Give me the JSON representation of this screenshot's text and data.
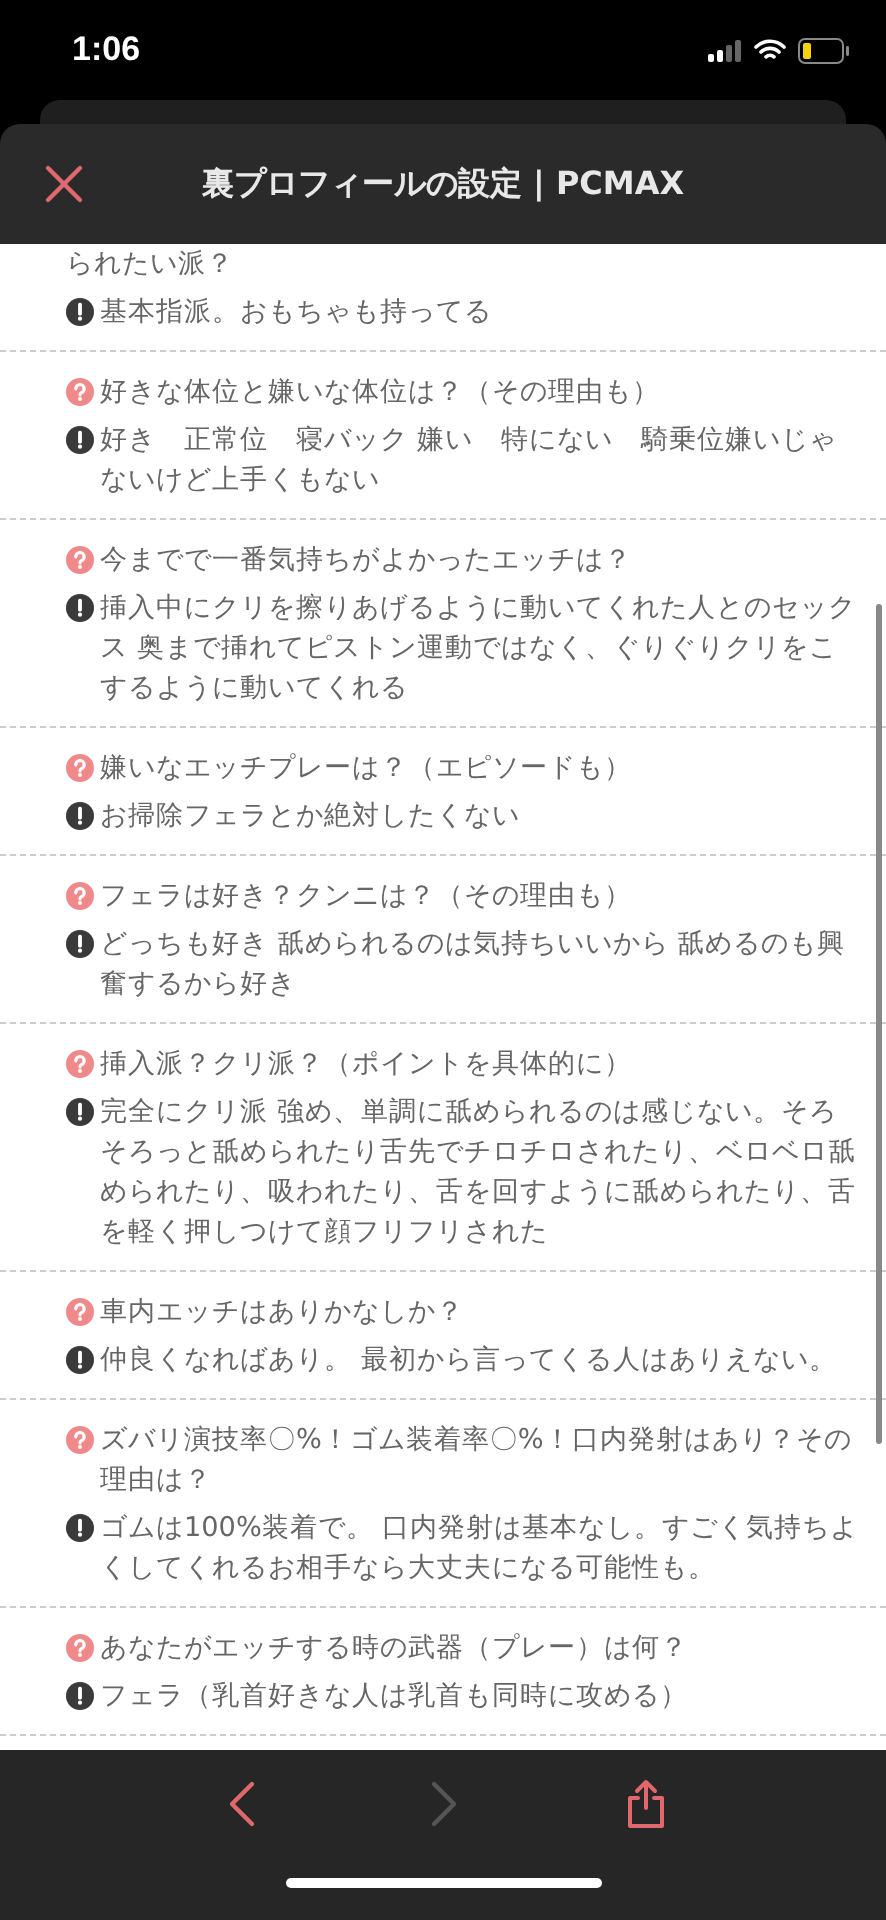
{
  "status_bar": {
    "time": "1:06"
  },
  "header": {
    "title": "裏プロフィールの設定 | PCMAX"
  },
  "items": [
    {
      "kind": "continued",
      "question": "られたい派？",
      "answer": "基本指派。おもちゃも持ってる"
    },
    {
      "kind": "full",
      "question": "好きな体位と嫌いな体位は？（その理由も）",
      "answer": "好き　正常位　寝バック 嫌い　特にない　騎乗位嫌いじゃないけど上手くもない"
    },
    {
      "kind": "full",
      "question": "今までで一番気持ちがよかったエッチは？",
      "answer": "挿入中にクリを擦りあげるように動いてくれた人とのセックス 奥まで挿れてピストン運動ではなく、ぐりぐりクリをこするように動いてくれる"
    },
    {
      "kind": "full",
      "question": "嫌いなエッチプレーは？（エピソードも）",
      "answer": "お掃除フェラとか絶対したくない"
    },
    {
      "kind": "full",
      "question": "フェラは好き？クンニは？（その理由も）",
      "answer": "どっちも好き 舐められるのは気持ちいいから 舐めるのも興奮するから好き"
    },
    {
      "kind": "full",
      "question": "挿入派？クリ派？（ポイントを具体的に）",
      "answer": "完全にクリ派 強め、単調に舐められるのは感じない。そろそろっと舐められたり舌先でチロチロされたり、ベロベロ舐められたり、吸われたり、舌を回すように舐められたり、舌を軽く押しつけて顔フリフリされた"
    },
    {
      "kind": "full",
      "question": "車内エッチはありかなしか？",
      "answer": "仲良くなればあり。 最初から言ってくる人はありえない。"
    },
    {
      "kind": "full",
      "question": "ズバリ演技率〇%！ゴム装着率〇%！口内発射はあり？その理由は？",
      "answer": "ゴムは100%装着で。 口内発射は基本なし。すごく気持ちよくしてくれるお相手なら大丈夫になる可能性も。"
    },
    {
      "kind": "full",
      "question": "あなたがエッチする時の武器（プレー）は何？",
      "answer": "フェラ（乳首好きな人は乳首も同時に攻める）"
    }
  ],
  "toolbar": {
    "back": {
      "disabled": false
    },
    "forward": {
      "disabled": true
    }
  }
}
